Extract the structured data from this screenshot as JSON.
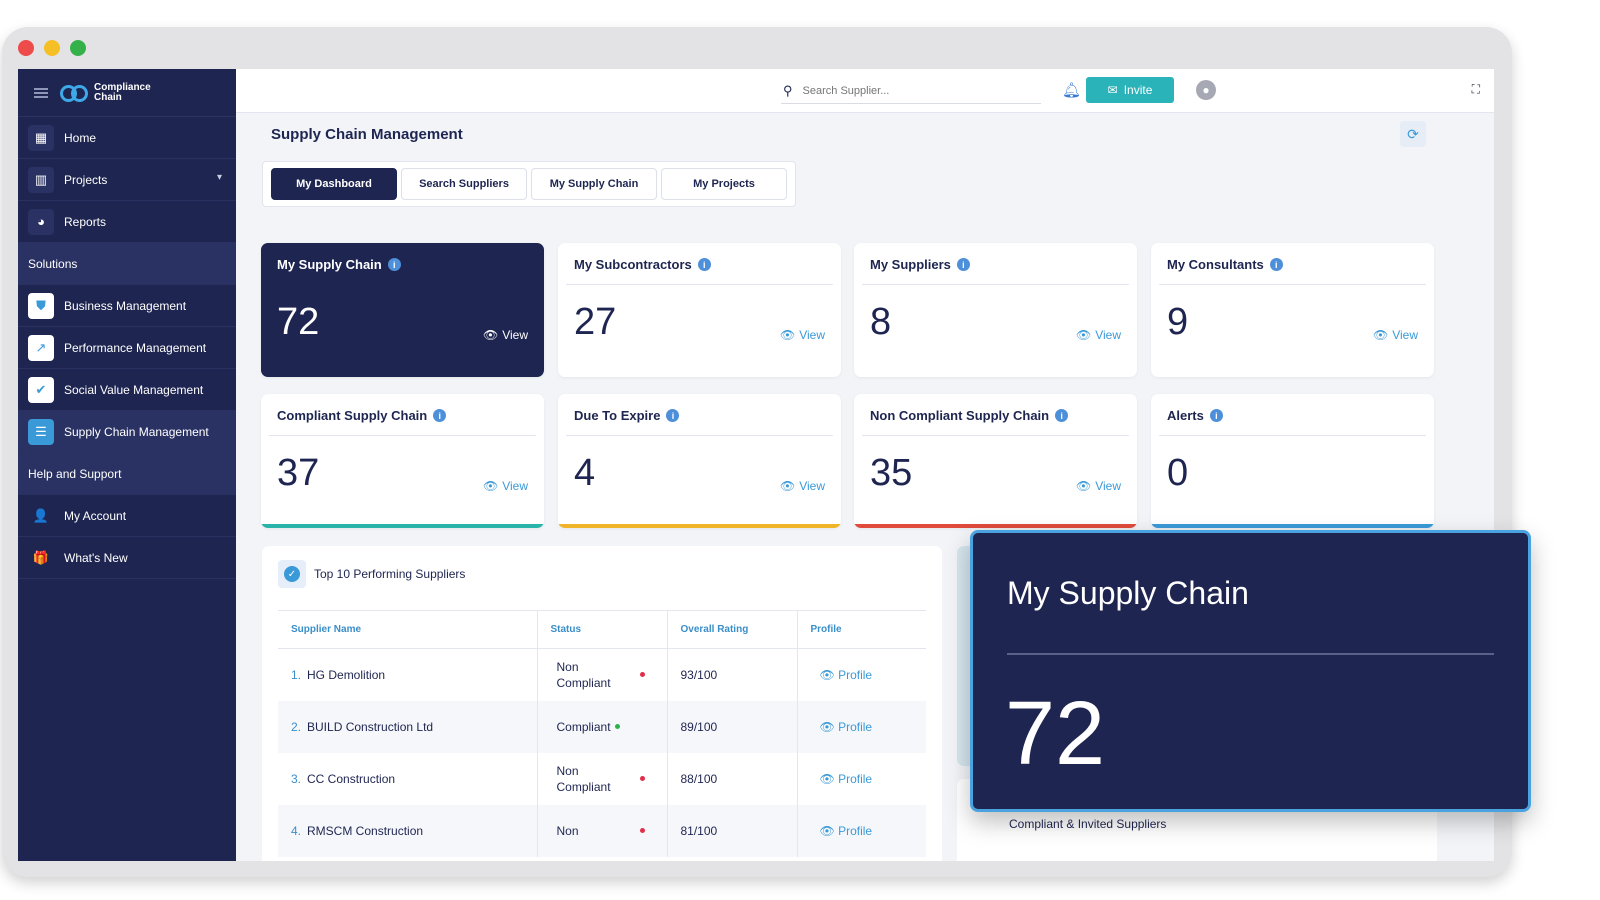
{
  "app": {
    "logo_line1": "Compliance",
    "logo_line2": "Chain"
  },
  "sidebar": {
    "items": [
      {
        "label": "Home",
        "icon": "grid-icon"
      },
      {
        "label": "Projects",
        "icon": "building-icon"
      },
      {
        "label": "Reports",
        "icon": "pie-chart-icon"
      }
    ],
    "solutions_header": "Solutions",
    "solutions": [
      {
        "label": "Business Management",
        "icon": "shield-icon",
        "color": "#3a9ad8"
      },
      {
        "label": "Performance Management",
        "icon": "arrow-up-right-icon",
        "color": "#3a9ad8"
      },
      {
        "label": "Social Value Management",
        "icon": "check-icon",
        "color": "#3a9ad8"
      },
      {
        "label": "Supply Chain Management",
        "icon": "supply-chain-icon",
        "color": "#3a9ad8"
      }
    ],
    "help_header": "Help and Support",
    "help": [
      {
        "label": "My Account",
        "icon": "user-cog-icon"
      },
      {
        "label": "What's New",
        "icon": "gift-icon"
      }
    ]
  },
  "topbar": {
    "search_placeholder": "Search Supplier...",
    "invite_label": "Invite"
  },
  "page": {
    "title": "Supply Chain Management",
    "tabs": [
      "My Dashboard",
      "Search Suppliers",
      "My Supply Chain",
      "My Projects"
    ],
    "active_tab": "My Dashboard"
  },
  "cards": [
    {
      "title": "My Supply Chain",
      "value": "72",
      "view": "View",
      "accent": "#1e2550"
    },
    {
      "title": "My Subcontractors",
      "value": "27",
      "view": "View",
      "accent": ""
    },
    {
      "title": "My Suppliers",
      "value": "8",
      "view": "View",
      "accent": ""
    },
    {
      "title": "My Consultants",
      "value": "9",
      "view": "View",
      "accent": ""
    },
    {
      "title": "Compliant Supply Chain",
      "value": "37",
      "view": "View",
      "accent": "#2ab3a8"
    },
    {
      "title": "Due To Expire",
      "value": "4",
      "view": "View",
      "accent": "#f0b429"
    },
    {
      "title": "Non Compliant Supply Chain",
      "value": "35",
      "view": "View",
      "accent": "#e04b3c"
    },
    {
      "title": "Alerts",
      "value": "0",
      "view": "",
      "accent": "#3a9ad8"
    }
  ],
  "top_suppliers": {
    "title": "Top 10 Performing Suppliers",
    "columns": [
      "Supplier Name",
      "Status",
      "Overall Rating",
      "Profile"
    ],
    "rows": [
      {
        "num": "1.",
        "name": "HG Demolition",
        "status": "Non Compliant",
        "status_color": "#e0304a",
        "rating": "93/100",
        "profile": "Profile"
      },
      {
        "num": "2.",
        "name": "BUILD Construction Ltd",
        "status": "Compliant",
        "status_color": "#2bb34a",
        "rating": "89/100",
        "profile": "Profile"
      },
      {
        "num": "3.",
        "name": "CC Construction",
        "status": "Non Compliant",
        "status_color": "#e0304a",
        "rating": "88/100",
        "profile": "Profile"
      },
      {
        "num": "4.",
        "name": "RMSCM Construction",
        "status": "Non",
        "status_color": "#e0304a",
        "rating": "81/100",
        "profile": "Profile"
      }
    ]
  },
  "lower_panel": {
    "text": "Compliant & Invited Suppliers"
  },
  "popout": {
    "title": "My Supply Chain",
    "value": "72"
  }
}
